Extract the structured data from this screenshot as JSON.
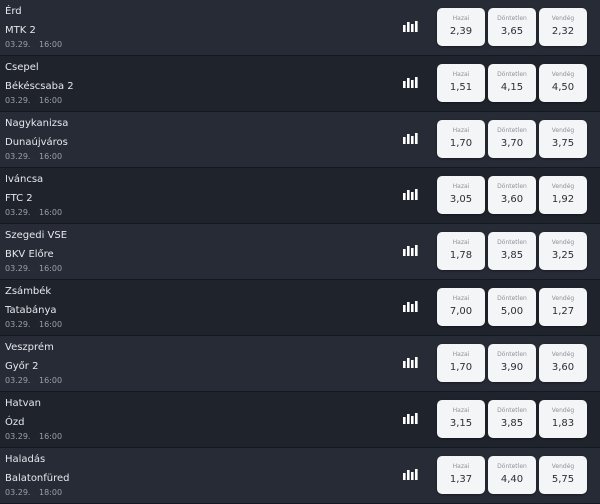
{
  "labels": {
    "home": "Hazai",
    "draw": "Döntetlen",
    "away": "Vendég"
  },
  "matches": [
    {
      "home": "Érd",
      "away": "MTK 2",
      "date": "03.29.",
      "time": "16:00",
      "odds": [
        "2,39",
        "3,65",
        "2,32"
      ]
    },
    {
      "home": "Csepel",
      "away": "Békéscsaba 2",
      "date": "03.29.",
      "time": "16:00",
      "odds": [
        "1,51",
        "4,15",
        "4,50"
      ]
    },
    {
      "home": "Nagykanizsa",
      "away": "Dunaújváros",
      "date": "03.29.",
      "time": "16:00",
      "odds": [
        "1,70",
        "3,70",
        "3,75"
      ]
    },
    {
      "home": "Iváncsa",
      "away": "FTC 2",
      "date": "03.29.",
      "time": "16:00",
      "odds": [
        "3,05",
        "3,60",
        "1,92"
      ]
    },
    {
      "home": "Szegedi VSE",
      "away": "BKV Előre",
      "date": "03.29.",
      "time": "16:00",
      "odds": [
        "1,78",
        "3,85",
        "3,25"
      ]
    },
    {
      "home": "Zsámbék",
      "away": "Tatabánya",
      "date": "03.29.",
      "time": "16:00",
      "odds": [
        "7,00",
        "5,00",
        "1,27"
      ]
    },
    {
      "home": "Veszprém",
      "away": "Győr 2",
      "date": "03.29.",
      "time": "16:00",
      "odds": [
        "1,70",
        "3,90",
        "3,60"
      ]
    },
    {
      "home": "Hatvan",
      "away": "Ózd",
      "date": "03.29.",
      "time": "16:00",
      "odds": [
        "3,15",
        "3,85",
        "1,83"
      ]
    },
    {
      "home": "Haladás",
      "away": "Balatonfüred",
      "date": "03.29.",
      "time": "18:00",
      "odds": [
        "1,37",
        "4,40",
        "5,75"
      ]
    }
  ],
  "colors": {
    "row_odd": "#262b35",
    "row_even": "#1f232c",
    "odds_button_bg": "#f4f5f7",
    "stats_icon": "#ffffff"
  },
  "icons": {
    "stats": "bar-chart-icon"
  }
}
